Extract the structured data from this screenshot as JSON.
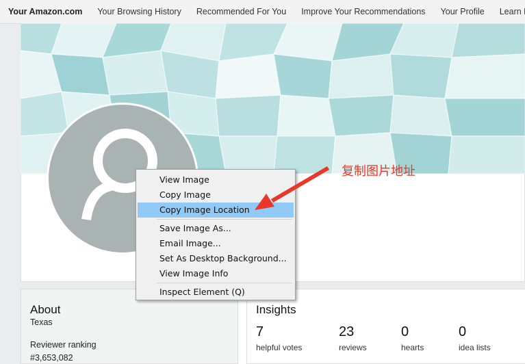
{
  "nav": {
    "items": [
      "Your Amazon.com",
      "Your Browsing History",
      "Recommended For You",
      "Improve Your Recommendations",
      "Your Profile",
      "Learn Mo"
    ]
  },
  "context_menu": {
    "items": [
      "View Image",
      "Copy Image",
      "Copy Image Location",
      "Save Image As...",
      "Email Image...",
      "Set As Desktop Background...",
      "View Image Info",
      "Inspect Element (Q)"
    ],
    "highlighted": "Copy Image Location"
  },
  "annotation": {
    "text": "复制图片地址",
    "color": "#e8382b"
  },
  "about": {
    "heading": "About",
    "location": "Texas",
    "ranking_label": "Reviewer ranking",
    "ranking_value": "#3,653,082"
  },
  "insights": {
    "heading": "Insights",
    "stats": [
      {
        "value": "7",
        "label": "helpful votes"
      },
      {
        "value": "23",
        "label": "reviews"
      },
      {
        "value": "0",
        "label": "hearts"
      },
      {
        "value": "0",
        "label": "idea lists"
      }
    ]
  },
  "colors": {
    "banner": "#cfe9ea",
    "avatar": "#aab3b4",
    "menu_highlight": "#91c9f7",
    "annotation": "#e8382b"
  }
}
